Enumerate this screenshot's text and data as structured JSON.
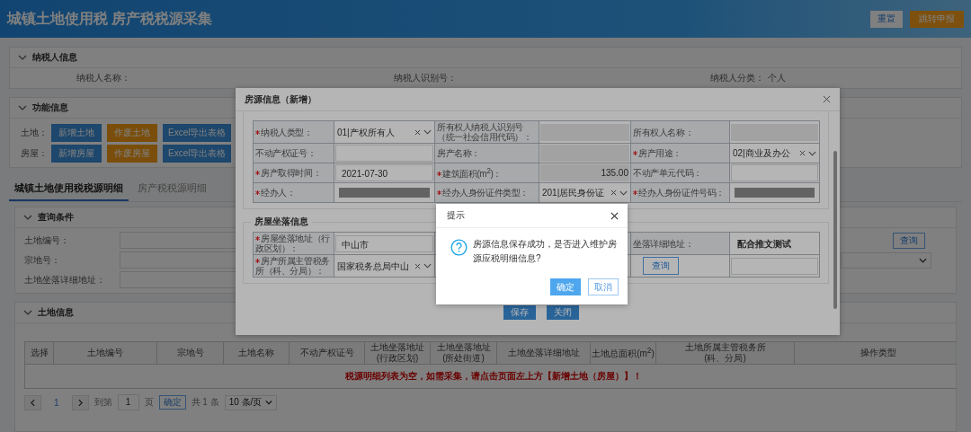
{
  "header": {
    "title": "城镇土地使用税 房产税税源采集",
    "buttons": [
      {
        "label": "重置",
        "kind": "plain"
      },
      {
        "label": "跳转申报",
        "kind": "primary"
      }
    ]
  },
  "taxpayer_panel": {
    "title": "纳税人信息",
    "expanded": true,
    "fields": [
      {
        "label": "纳税人名称："
      },
      {
        "label": "纳税人识别号："
      },
      {
        "label": "纳税人分类：",
        "value": "个人"
      }
    ]
  },
  "function_panel": {
    "title": "功能信息",
    "expanded": true,
    "rows": [
      {
        "label": "土地：",
        "buttons": [
          {
            "label": "新增土地",
            "kind": "add"
          },
          {
            "label": "作废土地",
            "kind": "void"
          },
          {
            "label": "Excel导出表格",
            "kind": "export"
          }
        ]
      },
      {
        "label": "房屋：",
        "buttons": [
          {
            "label": "新增房屋",
            "kind": "add"
          },
          {
            "label": "作废房屋",
            "kind": "void"
          },
          {
            "label": "Excel导出表格",
            "kind": "export"
          }
        ]
      }
    ]
  },
  "tabs": [
    {
      "label": "城镇土地使用税税源明细",
      "selected": true
    },
    {
      "label": "房产税税源明细",
      "selected": false
    }
  ],
  "query_panel": {
    "title": "查询条件",
    "expanded": true,
    "fields": [
      {
        "label": "土地编号：",
        "trailing": {
          "kind": "button",
          "label": "查询"
        }
      },
      {
        "label": "宗地号：",
        "trailing": {
          "kind": "select"
        }
      },
      {
        "label": "土地坐落详细地址："
      }
    ]
  },
  "land_panel": {
    "title": "土地信息",
    "expanded": true,
    "table": {
      "columns": [
        "选择",
        "土地编号",
        "宗地号",
        "土地名称",
        "不动产权证号",
        "土地坐落地址\n(行政区划)",
        "土地坐落地址\n(所处街道)",
        "土地坐落详细地址",
        "土地总面积(m$^{2}$)",
        "土地所属主管税务所\n(科、分局)",
        "操作类型"
      ],
      "empty_message": "税源明细列表为空，如需采集，请点击页面左上方【新增土地（房屋）】！"
    },
    "pager": {
      "current_page": "1",
      "goto_label": "到第",
      "goto_value": "1",
      "page_suffix": "页",
      "confirm": "确定",
      "total": "共 1 条",
      "page_size": "10 条/页"
    }
  },
  "house_dialog": {
    "title": "房源信息（新增）",
    "rows": [
      [
        {
          "kind": "label",
          "text": "纳税人类型：",
          "required": true
        },
        {
          "kind": "select",
          "value": "01|产权所有人"
        },
        {
          "kind": "label",
          "text": "所有权人纳税人识别号（统一社会信用代码）：",
          "required": false
        },
        {
          "kind": "input",
          "disabled": true
        },
        {
          "kind": "label",
          "text": "所有权人名称：",
          "required": false
        },
        {
          "kind": "input",
          "disabled": true
        }
      ],
      [
        {
          "kind": "label",
          "text": "不动产权证号：",
          "required": false
        },
        {
          "kind": "input",
          "disabled": false
        },
        {
          "kind": "label",
          "text": "房产名称：",
          "required": false
        },
        {
          "kind": "input",
          "disabled": true
        },
        {
          "kind": "label",
          "text": "房产用途：",
          "required": true
        },
        {
          "kind": "select",
          "value": "02|商业及办公"
        }
      ],
      [
        {
          "kind": "label",
          "text": "房产取得时间：",
          "required": true
        },
        {
          "kind": "input",
          "value": "2021-07-30",
          "disabled": false
        },
        {
          "kind": "label",
          "text": "建筑面积(m$^{2}$)：",
          "required": true
        },
        {
          "kind": "number",
          "value": "135.00",
          "disabled": true
        },
        {
          "kind": "label",
          "text": "不动产单元代码：",
          "required": false
        },
        {
          "kind": "input",
          "disabled": false
        }
      ],
      [
        {
          "kind": "label",
          "text": "经办人：",
          "required": true
        },
        {
          "kind": "redacted"
        },
        {
          "kind": "label",
          "text": "经办人身份证件类型：",
          "required": true
        },
        {
          "kind": "select",
          "value": "201|居民身份证"
        },
        {
          "kind": "label",
          "text": "经办人身份证件号码：",
          "required": true
        },
        {
          "kind": "redacted"
        }
      ]
    ],
    "location_section": {
      "title": "房屋坐落信息",
      "rows": [
        [
          {
            "kind": "label",
            "text": "房屋坐落地址（行政区划）：",
            "required": true
          },
          {
            "kind": "input",
            "value": "中山市",
            "disabled": false
          },
          {
            "kind": "label",
            "text": "坐落详细地址：",
            "required": false
          },
          {
            "kind": "text",
            "value": "配合推文测试"
          }
        ],
        [
          {
            "kind": "label",
            "text": "房产所属主管税务所（科、分局）：",
            "required": true
          },
          {
            "kind": "select",
            "value": "国家税务总局中山"
          },
          {
            "kind": "button",
            "label": "查询"
          },
          {
            "kind": "input",
            "disabled": false
          }
        ]
      ]
    },
    "buttons": [
      "保存",
      "关闭"
    ]
  },
  "prompt": {
    "title": "提示",
    "message": "房源信息保存成功，是否进入维护房源应税明细信息?",
    "buttons": [
      {
        "label": "确定",
        "kind": "primary"
      },
      {
        "label": "取消",
        "kind": "secondary"
      }
    ]
  }
}
